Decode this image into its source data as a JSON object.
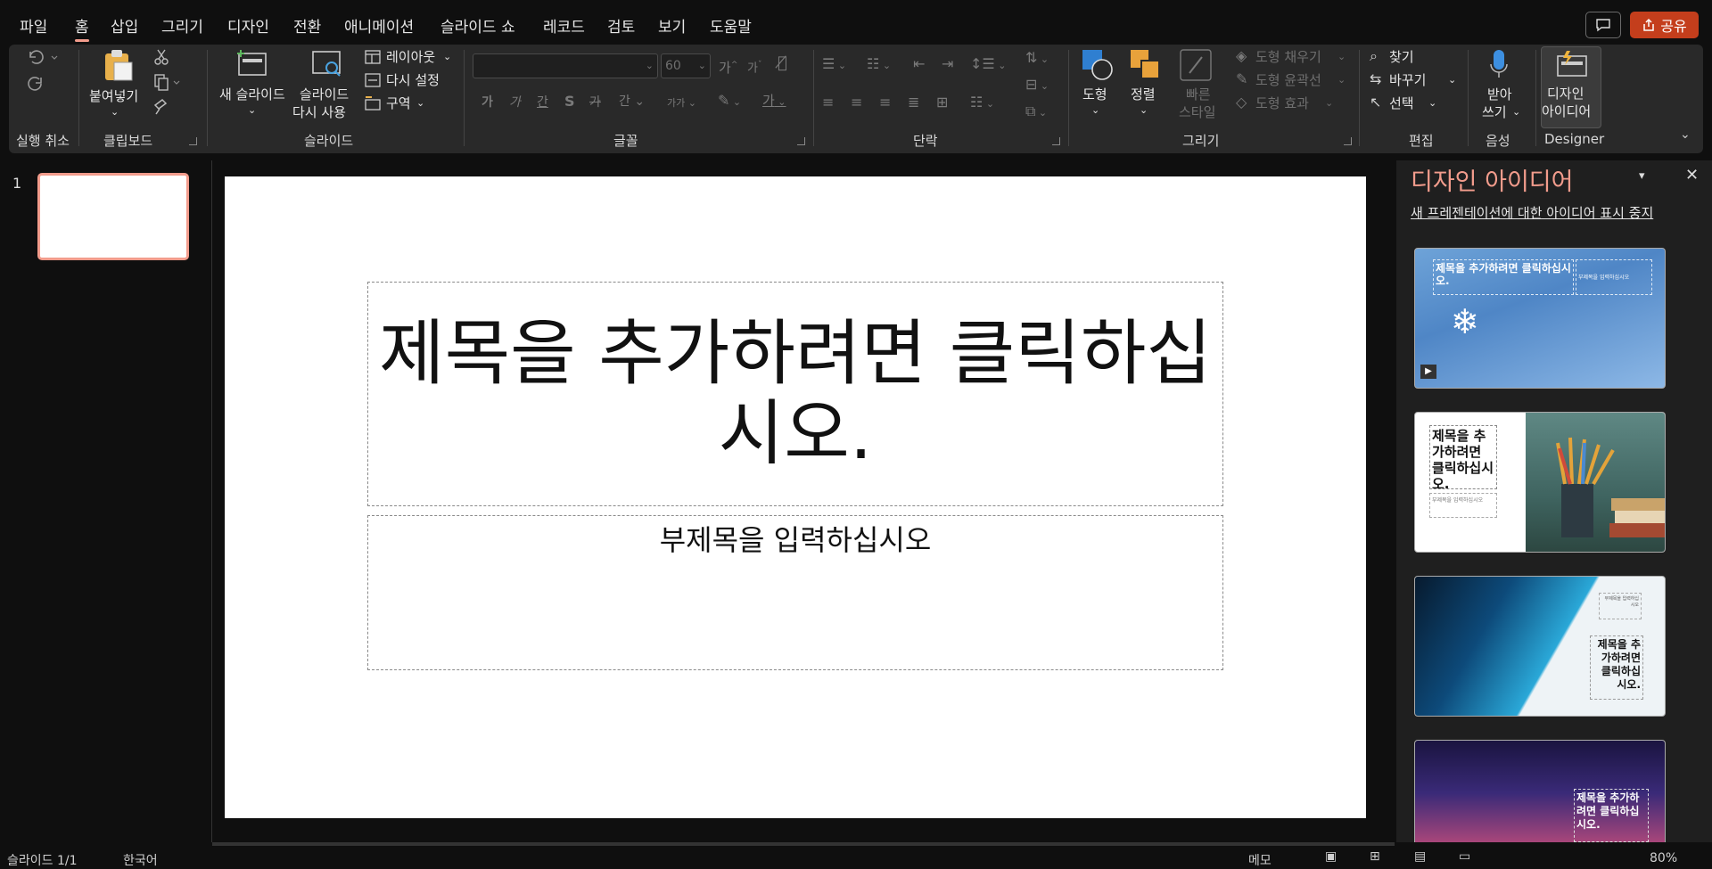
{
  "menu": {
    "file": "파일",
    "home": "홈",
    "insert": "삽입",
    "draw": "그리기",
    "design": "디자인",
    "transitions": "전환",
    "animations": "애니메이션",
    "slideshow": "슬라이드 쇼",
    "record": "레코드",
    "review": "검토",
    "view": "보기",
    "help": "도움말"
  },
  "share": {
    "label": "공유"
  },
  "ribbon": {
    "undo_group": "실행 취소",
    "clipboard": {
      "paste": "붙여넣기",
      "group": "클립보드"
    },
    "slides": {
      "new_slide": "새 슬라이드",
      "reuse_line1": "슬라이드",
      "reuse_line2": "다시 사용",
      "layout": "레이아웃",
      "reset": "다시 설정",
      "section": "구역",
      "group": "슬라이드"
    },
    "font": {
      "font_size": "60",
      "grow": "가",
      "shrink": "가",
      "bold": "가",
      "italic": "가",
      "underline": "간",
      "shadow": "S",
      "strike": "가",
      "spacing": "간",
      "case": "가가",
      "color": "가",
      "group": "글꼴"
    },
    "paragraph": {
      "group": "단락"
    },
    "drawing": {
      "shapes": "도형",
      "arrange": "정렬",
      "quick_styles_line1": "빠른",
      "quick_styles_line2": "스타일",
      "shape_fill": "도형 채우기",
      "shape_outline": "도형 윤곽선",
      "shape_effects": "도형 효과",
      "group": "그리기"
    },
    "editing": {
      "find": "찾기",
      "replace": "바꾸기",
      "select": "선택",
      "group": "편집"
    },
    "voice": {
      "dictate_line1": "받아",
      "dictate_line2": "쓰기",
      "group": "음성"
    },
    "designer": {
      "ideas_line1": "디자인",
      "ideas_line2": "아이디어",
      "group": "Designer"
    }
  },
  "thumbnails": {
    "slide_number": "1"
  },
  "slide": {
    "title_placeholder": "제목을 추가하려면 클릭하십시오.",
    "subtitle_placeholder": "부제목을 입력하십시오"
  },
  "designer_pane": {
    "title": "디자인 아이디어",
    "stop_link": "새 프레젠테이션에 대한 아이디어 표시 중지",
    "ideas": [
      {
        "title": "제목을 추가하려면 클릭하십시오.",
        "subtitle": "부제목을 입력하십시오"
      },
      {
        "title": "제목을 추가하려면 클릭하십시오.",
        "subtitle": "부제목을 입력하십시오"
      },
      {
        "title": "제목을 추가하려면 클릭하십시오.",
        "subtitle": "부제목을 입력하십시오"
      },
      {
        "title": "제목을 추가하려면 클릭하십시오."
      }
    ]
  },
  "status": {
    "slide_counter": "슬라이드 1/1",
    "language": "한국어",
    "notes": "메모",
    "zoom": "80%"
  },
  "colors": {
    "accent": "#f29c8c",
    "share": "#c43e1c",
    "ribbon_bg": "#292929"
  }
}
